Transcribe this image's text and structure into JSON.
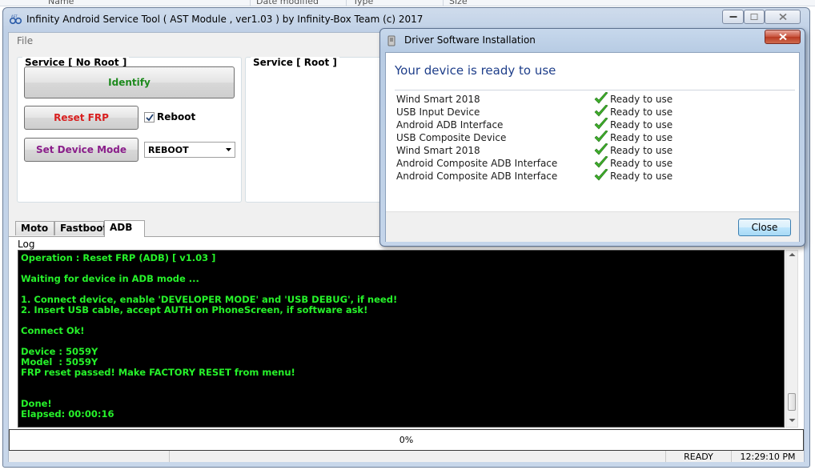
{
  "background": {
    "columns": [
      "Name",
      "Date modified",
      "Type",
      "Size"
    ]
  },
  "main_window": {
    "title": "Infinity Android Service Tool ( AST Module , ver1.03  ) by Infinity-Box Team (c) 2017",
    "menu": {
      "file": "File"
    },
    "no_root_group": {
      "title": "Service  [ No Root ]",
      "identify_label": "Identify",
      "reset_frp_label": "Reset FRP",
      "reboot_label": "Reboot",
      "reboot_checked": true,
      "set_mode_label": "Set Device Mode",
      "mode_value": "REBOOT"
    },
    "root_group": {
      "title": "Service [ Root ]"
    },
    "tabs": [
      {
        "label": "Moto",
        "active": false
      },
      {
        "label": "Fastboot",
        "active": false
      },
      {
        "label": "ADB",
        "active": true
      }
    ],
    "log_label": "Log",
    "log_lines": [
      "Operation : Reset FRP (ADB) [ v1.03 ]",
      "",
      "Waiting for device in ADB mode ...",
      "",
      "1. Connect device, enable 'DEVELOPER MODE' and 'USB DEBUG', if need!",
      "2. Insert USB cable, accept AUTH on PhoneScreen, if software ask!",
      "",
      "Connect Ok!",
      "",
      "Device : 5059Y",
      "Model  : 5059Y",
      "FRP reset passed! Make FACTORY RESET from menu!",
      "",
      "",
      "Done!",
      "Elapsed: 00:00:16"
    ],
    "progress": {
      "percent": 0,
      "text": "0%"
    },
    "status": {
      "state": "READY",
      "time": "12:29:10 PM"
    }
  },
  "dialog": {
    "title": "Driver Software Installation",
    "heading": "Your device is ready to use",
    "devices": [
      {
        "name": "Wind Smart 2018",
        "status": "Ready to use"
      },
      {
        "name": "USB Input Device",
        "status": "Ready to use"
      },
      {
        "name": "Android ADB Interface",
        "status": "Ready to use"
      },
      {
        "name": "USB Composite Device",
        "status": "Ready to use"
      },
      {
        "name": "Wind Smart 2018",
        "status": "Ready to use"
      },
      {
        "name": "Android Composite ADB Interface",
        "status": "Ready to use"
      },
      {
        "name": "Android Composite ADB Interface",
        "status": "Ready to use"
      }
    ],
    "close_label": "Close"
  },
  "colors": {
    "console_text": "#26f22a",
    "identify": "#1e8a1e",
    "reset_frp": "#d82020",
    "set_mode": "#8a1e8a",
    "dialog_heading": "#1e3e8a"
  }
}
